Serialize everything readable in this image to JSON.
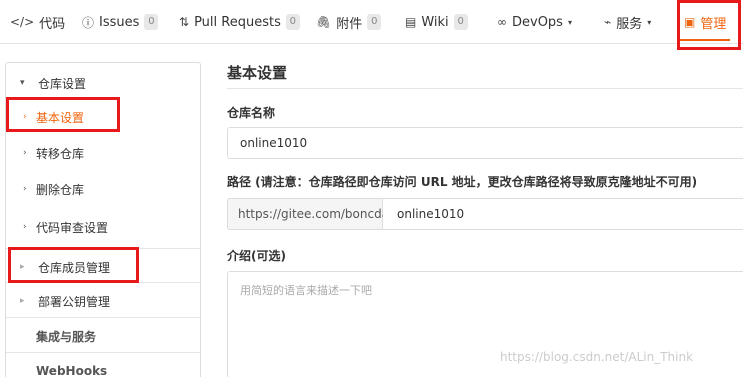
{
  "topnav": {
    "tabs": [
      {
        "icon": "</>",
        "label": "代码"
      },
      {
        "icon": "ⓘ",
        "label": "Issues",
        "badge": "0"
      },
      {
        "icon": "⇅",
        "label": "Pull Requests",
        "badge": "0"
      },
      {
        "icon": "🖇",
        "label": "附件",
        "badge": "0"
      },
      {
        "icon": "▤",
        "label": "Wiki",
        "badge": "0"
      },
      {
        "icon": "∞",
        "label": "DevOps",
        "caret": "▾"
      },
      {
        "icon": "⌁",
        "label": "服务",
        "caret": "▾"
      },
      {
        "icon": "▣",
        "label": "管理"
      }
    ],
    "accent": "#f0640e"
  },
  "sidebar": {
    "group_label": "仓库设置",
    "group_caret": "▾",
    "items": [
      {
        "label": "基本设置",
        "arrow": "›"
      },
      {
        "label": "转移仓库",
        "arrow": "›"
      },
      {
        "label": "删除仓库",
        "arrow": "›"
      },
      {
        "label": "代码审查设置",
        "arrow": "›"
      },
      {
        "label": "仓库成员管理",
        "arrow": "▸"
      },
      {
        "label": "部署公钥管理",
        "arrow": "▸"
      },
      {
        "label": "集成与服务"
      },
      {
        "label": "WebHooks"
      }
    ]
  },
  "main": {
    "title": "基本设置",
    "repo_name_label": "仓库名称",
    "repo_name_value": "online1010",
    "path_label": "路径 (请注意：仓库路径即仓库访问 URL 地址，更改仓库路径将导致原克隆地址不可用)",
    "path_prefix": "https://gitee.com/boncda/",
    "path_value": "online1010",
    "intro_label": "介绍(可选)",
    "intro_placeholder": "用简短的语言来描述一下吧"
  },
  "watermark": "https://blog.csdn.net/ALin_Think",
  "highlight_color": "#e8191b"
}
